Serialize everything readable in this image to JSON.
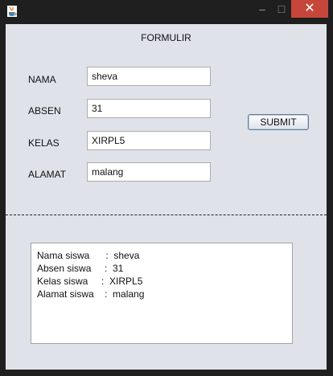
{
  "window": {
    "icon": "java-cup-icon",
    "controls": {
      "minimize": "–",
      "maximize": "□",
      "close": "✕"
    }
  },
  "form": {
    "title": "FORMULIR",
    "fields": [
      {
        "label": "NAMA",
        "value": "sheva"
      },
      {
        "label": "ABSEN",
        "value": "31"
      },
      {
        "label": "KELAS",
        "value": "XIRPL5"
      },
      {
        "label": "ALAMAT",
        "value": "malang"
      }
    ],
    "submit_label": "SUBMIT"
  },
  "output": {
    "lines": [
      "Nama siswa      :  sheva",
      "Absen siswa     :  31",
      "Kelas siswa     :  XIRPL5",
      "Alamat siswa    :  malang"
    ]
  },
  "colors": {
    "background": "#dfe3e9",
    "close_button": "#c7463b",
    "titlebar": "#1f1f1f"
  }
}
